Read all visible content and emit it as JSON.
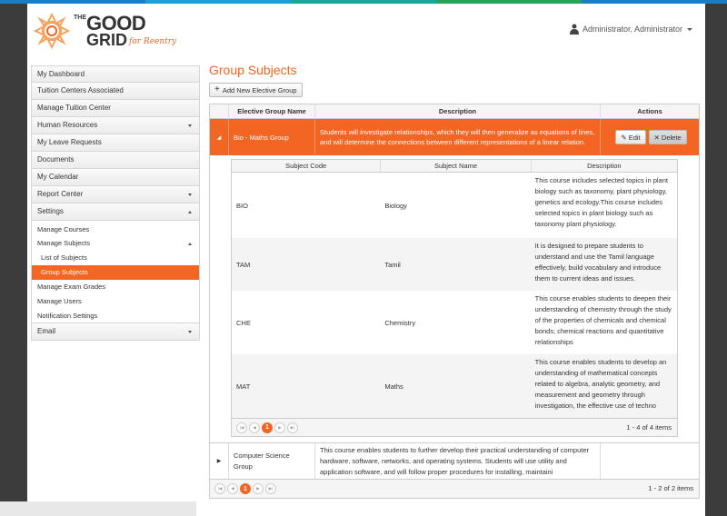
{
  "colors": {
    "accent": "#f26522",
    "topbar": [
      "#1b7fc3",
      "#1ba0d8",
      "#17a89b",
      "#25a35a",
      "#1b7fc3"
    ]
  },
  "header": {
    "logo_the": "THE",
    "logo_line1": "GOOD",
    "logo_line2": "GRID",
    "logo_tag": "for Reentry",
    "user_name": "Administrator, Administrator"
  },
  "sidebar": {
    "items": [
      {
        "label": "My Dashboard",
        "arrow": ""
      },
      {
        "label": "Tuition Centers Associated",
        "arrow": ""
      },
      {
        "label": "Manage Tuition Center",
        "arrow": ""
      },
      {
        "label": "Human Resources",
        "arrow": "down"
      },
      {
        "label": "My Leave Requests",
        "arrow": ""
      },
      {
        "label": "Documents",
        "arrow": ""
      },
      {
        "label": "My Calendar",
        "arrow": ""
      },
      {
        "label": "Report Center",
        "arrow": "down"
      },
      {
        "label": "Settings",
        "arrow": "up"
      }
    ],
    "settings_sub": [
      "Manage Courses",
      "Manage Subjects",
      "List of Subjects",
      "Group Subjects",
      "Manage Exam Grades",
      "Manage Users",
      "Notification Settings"
    ],
    "email": "Email"
  },
  "main": {
    "title": "Group Subjects",
    "add_label": "Add New Elective Group",
    "columns": [
      "Elective Group Name",
      "Description",
      "Actions"
    ],
    "edit_label": "Edit",
    "delete_label": "Delete",
    "groups": [
      {
        "name": "Bio - Maths Group",
        "description": "Students will investigate relationships, which they will then generalize as equations of lines, and will determine the connections between different representations of a linear relation."
      },
      {
        "name": "Computer Science Group",
        "description": "This course enables students to further develop their practical understanding of computer hardware, software, networks, and operating systems. Students will use utility and application software, and will follow proper procedures for installing, maintaini"
      }
    ],
    "sub_columns": [
      "Subject Code",
      "Subject Name",
      "Description"
    ],
    "subjects": [
      {
        "code": "BIO",
        "name": "Biology",
        "description": "This course includes selected topics in plant biology such as taxonomy, plant physiology, genetics and ecology.This course includes selected topics in plant biology such as taxonomy plant physiology."
      },
      {
        "code": "TAM",
        "name": "Tamil",
        "description": "It is designed to prepare students to understand and use the Tamil language effectively, build vocabulary and introduce them to current ideas and issues."
      },
      {
        "code": "CHE",
        "name": "Chemistry",
        "description": "This course enables students to deepen their understanding of chemistry through the study of the properties of chemicals and chemical bonds; chemical reactions and quantitative relationships"
      },
      {
        "code": "MAT",
        "name": "Maths",
        "description": "This course enables students to develop an understanding of mathematical concepts related to algebra, analytic geometry, and measurement and geometry through investigation, the effective use of techno"
      }
    ],
    "sub_pager": {
      "page": "1",
      "info": "1 - 4 of 4 items"
    },
    "pager": {
      "page": "1",
      "info": "1 - 2 of 2 items"
    }
  }
}
